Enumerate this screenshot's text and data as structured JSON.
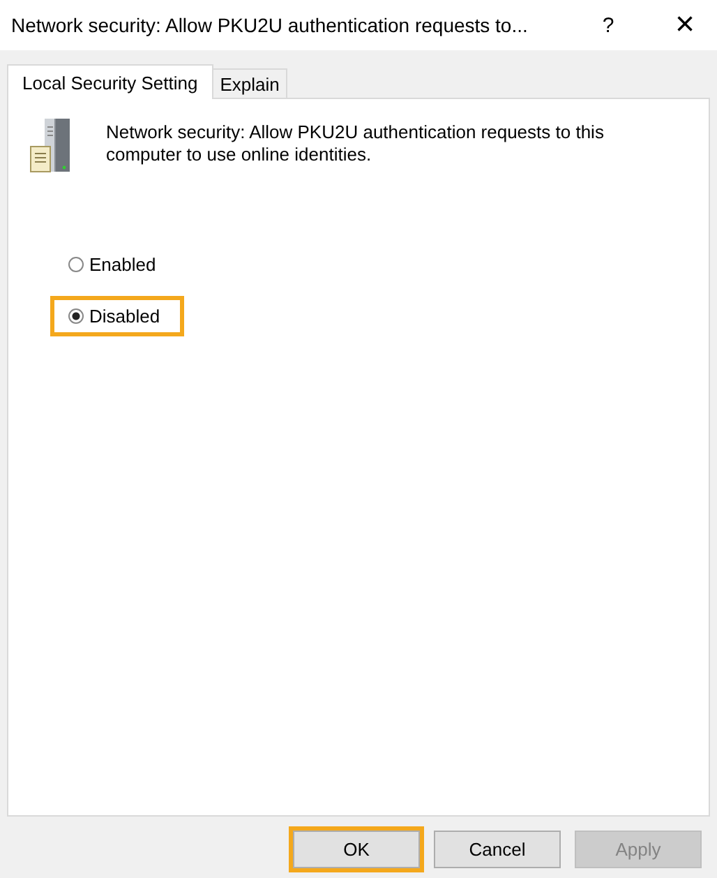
{
  "window": {
    "title": "Network security: Allow PKU2U authentication requests to...",
    "help": "?",
    "close": "×"
  },
  "tabs": [
    {
      "label": "Local Security Setting",
      "selected": true
    },
    {
      "label": "Explain",
      "selected": false
    }
  ],
  "description": "Network security: Allow PKU2U authentication requests to this computer to use online identities.",
  "options": [
    {
      "label": "Enabled",
      "selected": false,
      "highlighted": false
    },
    {
      "label": "Disabled",
      "selected": true,
      "highlighted": true
    }
  ],
  "buttons": [
    {
      "label": "OK",
      "disabled": false,
      "highlighted": true
    },
    {
      "label": "Cancel",
      "disabled": false,
      "highlighted": false
    },
    {
      "label": "Apply",
      "disabled": true,
      "highlighted": false
    }
  ]
}
